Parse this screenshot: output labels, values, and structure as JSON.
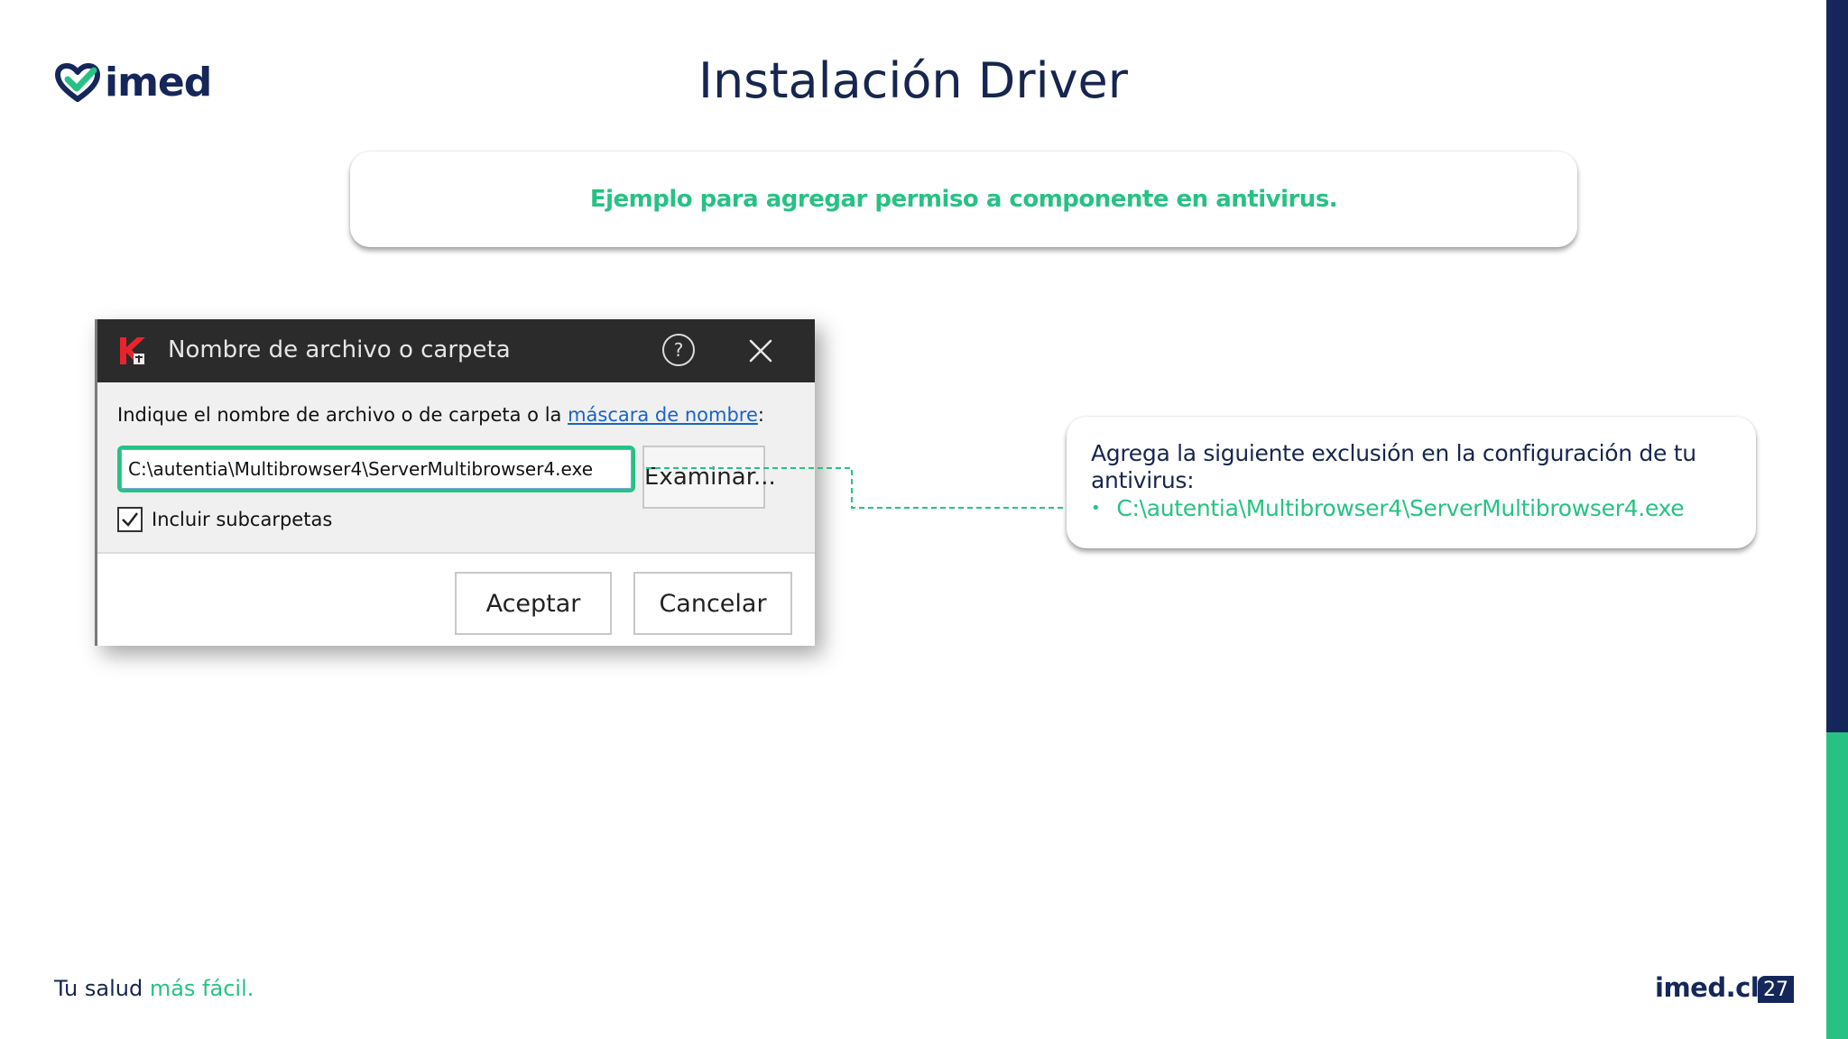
{
  "brand": {
    "logo_text": "imed",
    "tagline_prefix": "Tu salud",
    "tagline_accent": "más fácil.",
    "footer_logo": "imed.cl",
    "colors": {
      "navy": "#15275a",
      "green": "#27c283"
    }
  },
  "slide": {
    "title": "Instalación Driver",
    "page_number": "27",
    "banner": "Ejemplo para agregar permiso a componente en antivirus."
  },
  "dialog": {
    "app_icon": "kaspersky-k-icon",
    "title": "Nombre de archivo o carpeta",
    "help_icon": "help-icon",
    "close_icon": "close-icon",
    "prompt_text": "Indique el nombre de archivo o de carpeta o la ",
    "prompt_link": "máscara de nombre",
    "prompt_suffix": ":",
    "path_value": "C:\\autentia\\Multibrowser4\\ServerMultibrowser4.exe",
    "browse_label": "Examinar...",
    "include_subfolders_label": "Incluir subcarpetas",
    "include_subfolders_checked": true,
    "accept_label": "Aceptar",
    "cancel_label": "Cancelar"
  },
  "info_card": {
    "text": "Agrega la siguiente exclusión en la configuración de tu antivirus:",
    "bullet": "C:\\autentia\\Multibrowser4\\ServerMultibrowser4.exe"
  }
}
